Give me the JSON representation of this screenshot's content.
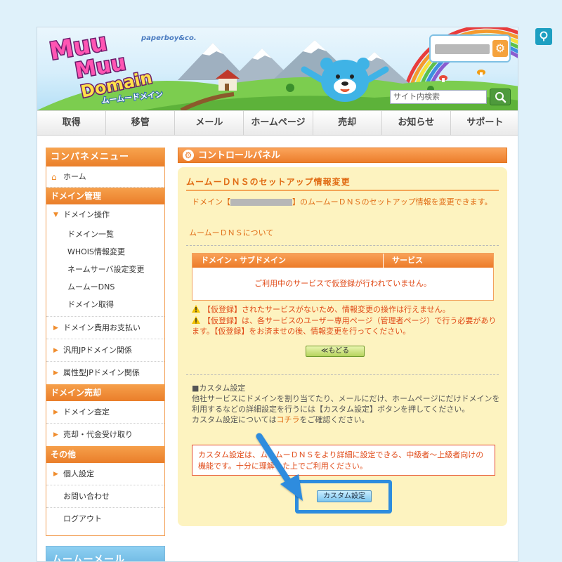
{
  "header": {
    "logo_text_line1": "Muu",
    "logo_text_line2": "Muu",
    "logo_text_line3": "Domain",
    "logo_kana": "ムームードメイン",
    "brand": "paperboy&co.",
    "search_placeholder": "サイト内検索"
  },
  "nav": {
    "items": [
      "取得",
      "移管",
      "メール",
      "ホームページ",
      "売却",
      "お知らせ",
      "サポート"
    ]
  },
  "sidebar": {
    "title": "コンパネメニュー",
    "home": "ホーム",
    "sections": [
      {
        "label": "ドメイン管理",
        "domain_ops": "ドメイン操作",
        "sub_items": [
          "ドメイン一覧",
          "WHOIS情報変更",
          "ネームサーバ設定変更",
          "ムームーDNS",
          "ドメイン取得"
        ],
        "items": [
          "ドメイン費用お支払い",
          "汎用JPドメイン関係",
          "属性型JPドメイン関係"
        ]
      },
      {
        "label": "ドメイン売却",
        "items": [
          "ドメイン査定",
          "売却・代金受け取り"
        ]
      },
      {
        "label": "その他",
        "items": [
          "個人設定",
          "お問い合わせ",
          "ログアウト"
        ]
      }
    ],
    "next_box": "ムームーメール"
  },
  "main": {
    "panel_title": "コントロールパネル",
    "section_title": "ムームーＤＮＳのセットアップ情報変更",
    "desc_before": "ドメイン【",
    "desc_after": "】のムームーＤＮＳのセットアップ情報を変更できます。",
    "about_link": "ムームーＤＮＳについて",
    "table": {
      "col1": "ドメイン・サブドメイン",
      "col2": "サービス",
      "empty": "ご利用中のサービスで仮登録が行われていません。"
    },
    "warnings": [
      "【仮登録】されたサービスがないため、情報変更の操作は行えません。",
      "【仮登録】は、各サービスのユーザー専用ページ（管理者ページ）で行う必要があります。【仮登録】をお済ませの後、情報変更を行ってください。"
    ],
    "back_button": "≪もどる",
    "custom_title": "■カスタム設定",
    "custom_desc": "他社サービスにドメインを割り当てたり、メールにだけ、ホームページにだけドメインを利用するなどの詳細設定を行うには【カスタム設定】ボタンを押してください。",
    "custom_desc2_before": "カスタム設定についてはコチラ",
    "custom_desc2_link": "コチラ",
    "custom_desc2_after": "をご確認ください。",
    "alert": "カスタム設定は、ムームーＤＮＳをより詳細に設定できる、中級者～上級者向けの機能です。十分に理解した上でご利用ください。",
    "custom_button": "カスタム設定"
  },
  "colors": {
    "accent_orange": "#ec7d2c",
    "highlight_blue": "#2d8cde",
    "panel_bg": "#fdf3c0",
    "warning_red": "#e04a17"
  }
}
